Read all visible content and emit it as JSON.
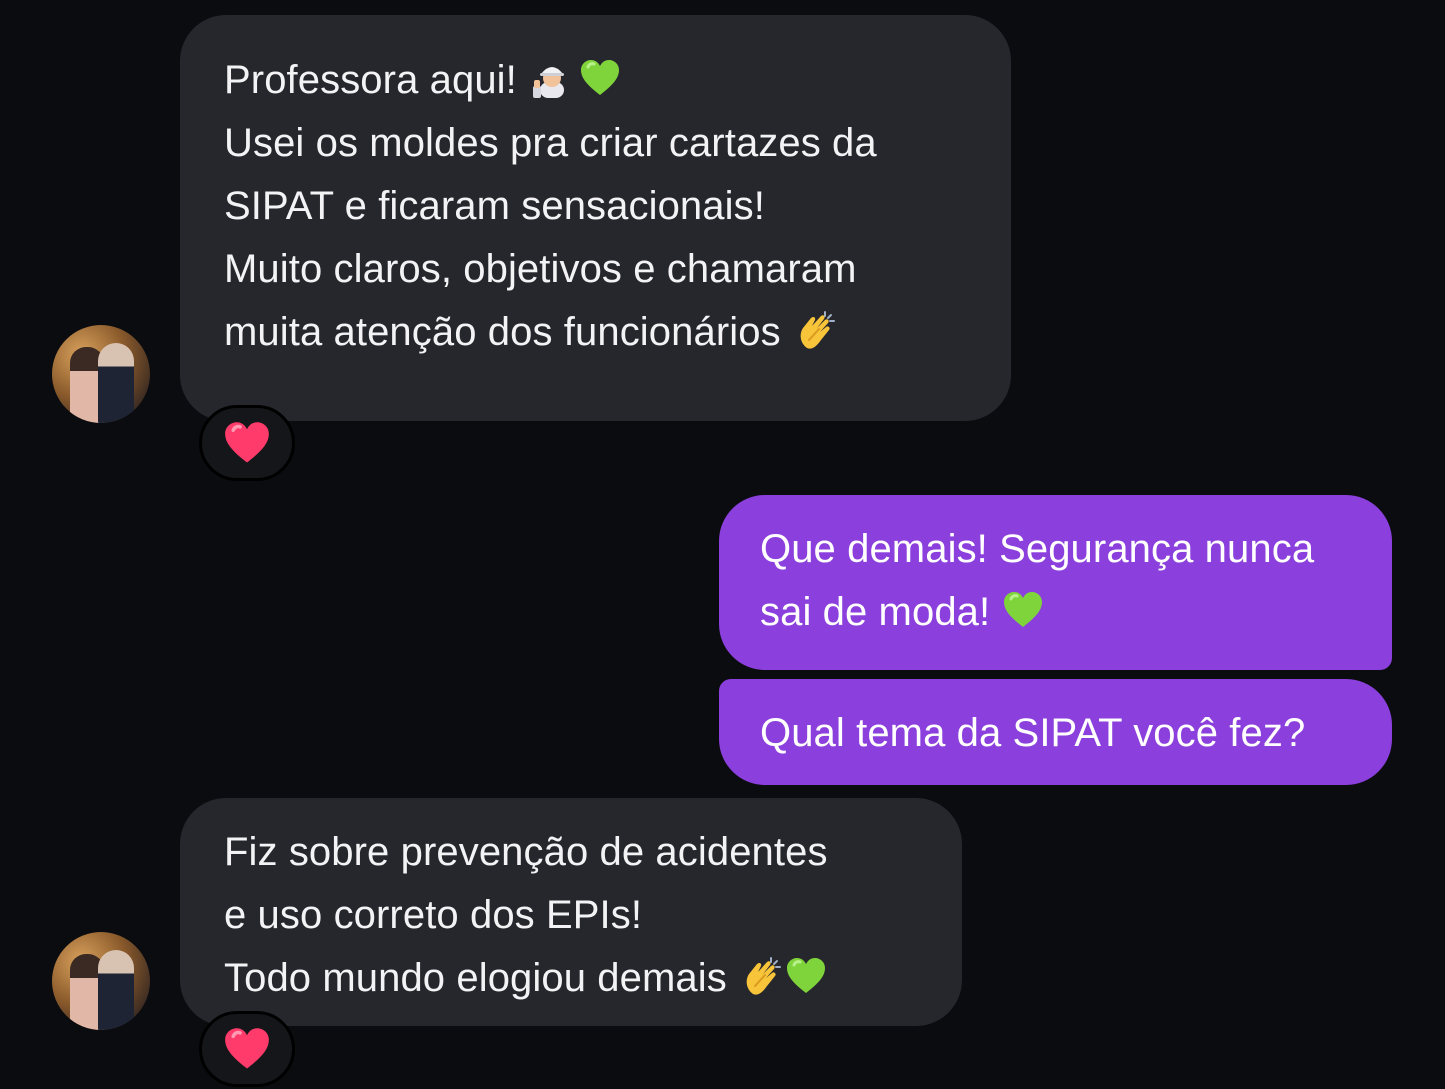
{
  "colors": {
    "background": "#0b0c10",
    "incoming_bubble": "#26272d",
    "outgoing_bubble": "#8b3fdc",
    "text": "#f3f3f5",
    "reaction_heart": "#ff3b6b"
  },
  "messages": [
    {
      "direction": "incoming",
      "lines": [
        "Professora aqui!",
        "Usei os moldes pra criar cartazes da",
        "SIPAT e ficaram sensacionais!",
        "Muito claros, objetivos e chamaram",
        "muita atenção dos funcionários"
      ],
      "emojis": {
        "line0": [
          "construction-worker-woman-emoji",
          "green-heart-emoji"
        ],
        "line4": [
          "clapping-hands-emoji"
        ]
      },
      "reaction": "red-heart"
    },
    {
      "direction": "outgoing",
      "lines": [
        "Que demais! Segurança nunca",
        "sai de moda!"
      ],
      "emojis": {
        "line1": [
          "green-heart-emoji"
        ]
      }
    },
    {
      "direction": "outgoing",
      "lines": [
        "Qual tema da SIPAT você fez?"
      ]
    },
    {
      "direction": "incoming",
      "lines": [
        "Fiz sobre prevenção de acidentes",
        "e uso correto dos EPIs!",
        "Todo mundo elogiou demais"
      ],
      "emojis": {
        "line2": [
          "clapping-hands-emoji",
          "green-heart-emoji"
        ]
      },
      "reaction": "red-heart"
    }
  ]
}
